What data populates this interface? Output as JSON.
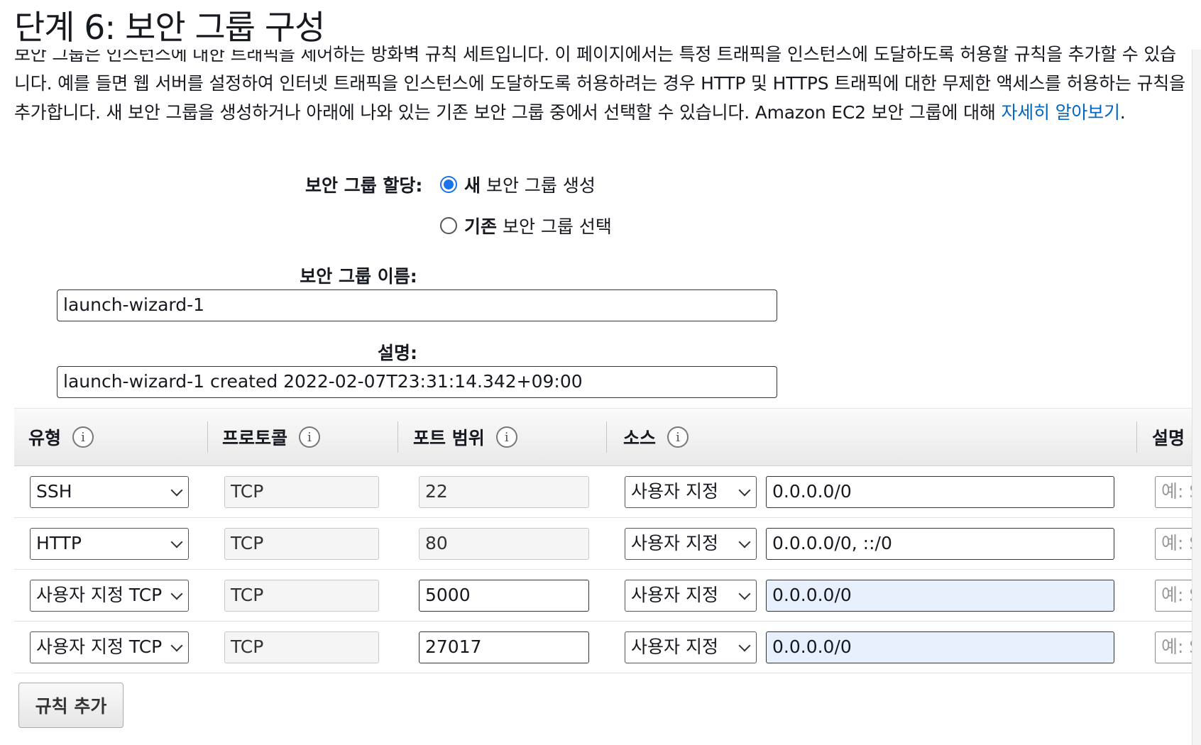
{
  "page": {
    "title": "단계 6: 보안 그룹 구성",
    "intro_text": "보안 그룹은 인스턴스에 대한 트래픽을 제어하는 방화벽 규칙 세트입니다. 이 페이지에서는 특정 트래픽을 인스턴스에 도달하도록 허용할 규칙을 추가할 수 있습니다. 예를 들면 웹 서버를 설정하여 인터넷 트래픽을 인스턴스에 도달하도록 허용하려는 경우 HTTP 및 HTTPS 트래픽에 대한 무제한 액세스를 허용하는 규칙을 추가합니다. 새 보안 그룹을 생성하거나 아래에 나와 있는 기존 보안 그룹 중에서 선택할 수 있습니다. Amazon EC2 보안 그룹에 대해 ",
    "learn_more_link": "자세히 알아보기",
    "learn_more_suffix": "."
  },
  "assign": {
    "label": "보안 그룹 할당:",
    "options": [
      {
        "bold": "새",
        "rest": " 보안 그룹 생성",
        "checked": true
      },
      {
        "bold": "기존",
        "rest": " 보안 그룹 선택",
        "checked": false
      }
    ]
  },
  "group_name": {
    "label": "보안 그룹 이름:",
    "value": "launch-wizard-1"
  },
  "description": {
    "label": "설명:",
    "value": "launch-wizard-1 created 2022-02-07T23:31:14.342+09:00"
  },
  "rules": {
    "columns": [
      "유형",
      "프로토콜",
      "포트 범위",
      "소스",
      "설명"
    ],
    "rows": [
      {
        "type": "SSH",
        "protocol": "TCP",
        "port": "22",
        "source_type": "사용자 지정",
        "source": "0.0.0.0/0",
        "desc_placeholder": "예: S"
      },
      {
        "type": "HTTP",
        "protocol": "TCP",
        "port": "80",
        "source_type": "사용자 지정",
        "source": "0.0.0.0/0, ::/0",
        "desc_placeholder": "예: S"
      },
      {
        "type": "사용자 지정 TCP",
        "protocol": "TCP",
        "port": "5000",
        "source_type": "사용자 지정",
        "source": "0.0.0.0/0",
        "desc_placeholder": "예: S"
      },
      {
        "type": "사용자 지정 TCP",
        "protocol": "TCP",
        "port": "27017",
        "source_type": "사용자 지정",
        "source": "0.0.0.0/0",
        "desc_placeholder": "예: S"
      }
    ]
  },
  "actions": {
    "add_rule": "규칙 추가"
  }
}
